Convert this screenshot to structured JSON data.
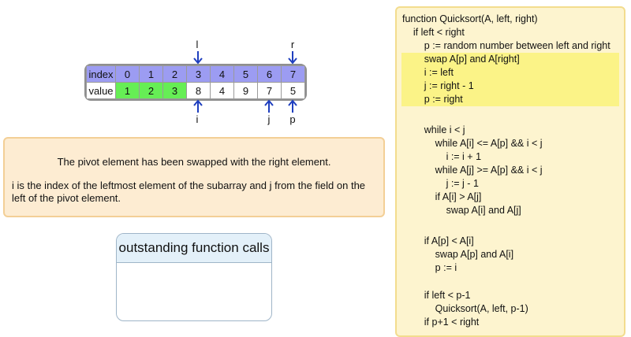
{
  "array": {
    "index_label": "index",
    "value_label": "value",
    "indices": [
      "0",
      "1",
      "2",
      "3",
      "4",
      "5",
      "6",
      "7"
    ],
    "values": [
      "1",
      "2",
      "3",
      "8",
      "4",
      "9",
      "7",
      "5"
    ],
    "sorted_positions": [
      0,
      1,
      2
    ]
  },
  "markers": {
    "top_l": "l",
    "top_r": "r",
    "bottom_i": "i",
    "bottom_j": "j",
    "bottom_p": "p"
  },
  "message": {
    "line1": "The pivot element has been swapped with the right element.",
    "line2": "i is the index of the leftmost element of the subarray and j from the field on the left of the pivot element."
  },
  "calls_panel": {
    "title": "outstanding function calls"
  },
  "code": {
    "lines": [
      "function Quicksort(A, left, right)",
      "    if left < right",
      "        p := random number between left and right",
      "        swap A[p] and A[right]",
      "        i := left",
      "        j := right - 1",
      "        p := right",
      "",
      "        while i < j",
      "            while A[i] <= A[p] && i < j",
      "                i := i + 1",
      "            while A[j] >= A[p] && i < j",
      "                j := j - 1",
      "            if A[i] > A[j]",
      "                swap A[i] and A[j]",
      "",
      "        if A[p] < A[i]",
      "            swap A[p] and A[i]",
      "            p := i",
      "",
      "        if left < p-1",
      "            Quicksort(A, left, p-1)",
      "        if p+1 < right"
    ],
    "highlighted": [
      3,
      4,
      5,
      6
    ],
    "highlight_color": "#fbf387"
  },
  "colors": {
    "index_row": "#9c9cf2",
    "sorted_cell": "#66ee55",
    "arrow": "#1f3fbf"
  }
}
